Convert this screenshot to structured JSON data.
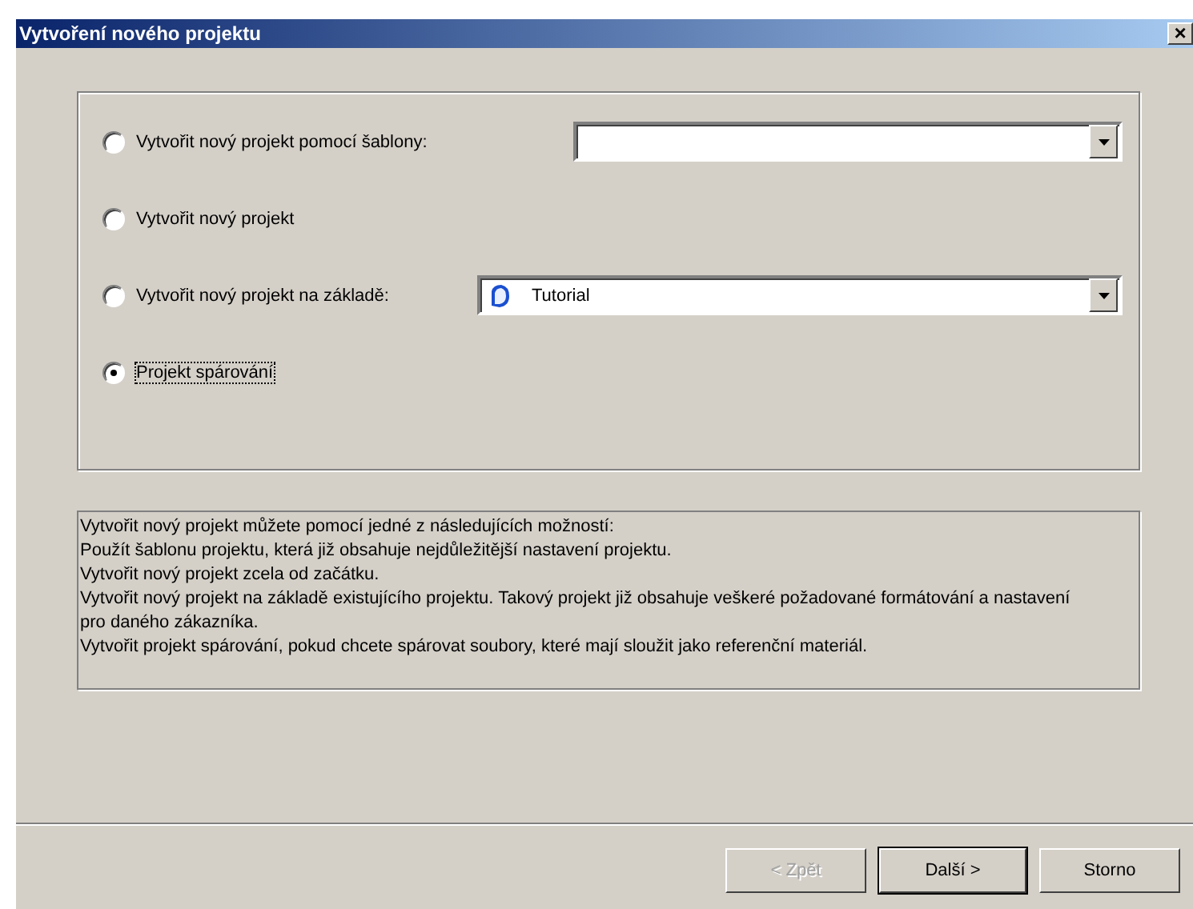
{
  "window": {
    "title": "Vytvoření nového projektu",
    "close": "×"
  },
  "options": [
    {
      "kind": "combo",
      "label": "Vytvořit nový projekt pomocí šablony:",
      "selected": false,
      "icon": false
    },
    {
      "kind": "plain",
      "label": "Vytvořit nový projekt",
      "selected": false
    },
    {
      "kind": "combo",
      "label": "Vytvořit nový projekt na základě:",
      "selected": false,
      "value": "Tutorial",
      "icon": true
    },
    {
      "kind": "plain",
      "label": "Projekt spárování",
      "selected": true
    }
  ],
  "description": [
    "Vytvořit nový projekt můžete pomocí jedné z následujících možností:",
    "Použít šablonu projektu, která již obsahuje nejdůležitější nastavení projektu.",
    "Vytvořit nový projekt zcela od začátku.",
    "Vytvořit nový projekt na základě existujícího projektu. Takový projekt již obsahuje veškeré požadované formátování a nastavení pro daného zákazníka.",
    "Vytvořit projekt spárování, pokud chcete spárovat soubory, které mají sloužit jako referenční materiál."
  ],
  "buttons": [
    {
      "label": "< Zpět",
      "disabled": true,
      "default": false
    },
    {
      "label": "Další >",
      "disabled": false,
      "default": true
    },
    {
      "label": "Storno",
      "disabled": false,
      "default": false
    }
  ]
}
